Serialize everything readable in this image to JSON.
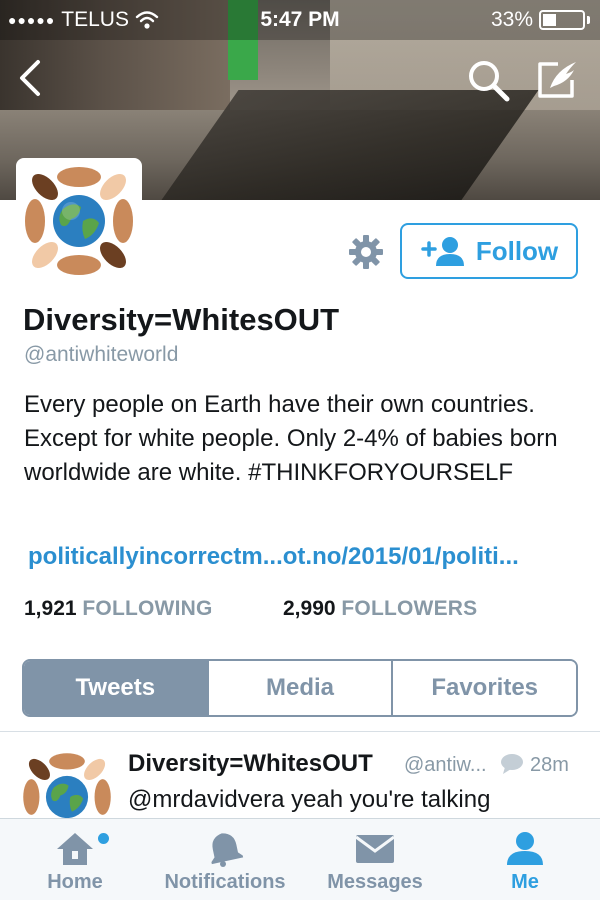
{
  "status_bar": {
    "signal_dots": "●●●●●",
    "carrier": "TELUS",
    "time": "5:47 PM",
    "battery_percent": "33%",
    "battery_level": 0.33
  },
  "header": {
    "back_icon": "chevron-left-icon",
    "search_icon": "search-icon",
    "compose_icon": "compose-icon"
  },
  "profile": {
    "display_name": "Diversity=WhitesOUT",
    "handle": "@antiwhiteworld",
    "bio": "Every people on Earth have their own countries. Except for white people. Only 2-4% of babies born worldwide are white. #THINKFORYOURSELF",
    "website": "politicallyincorrectm...ot.no/2015/01/politi...",
    "following_count": "1,921",
    "following_label": "FOLLOWING",
    "followers_count": "2,990",
    "followers_label": "FOLLOWERS",
    "follow_label": "Follow"
  },
  "tabs": [
    {
      "label": "Tweets",
      "active": true
    },
    {
      "label": "Media",
      "active": false
    },
    {
      "label": "Favorites",
      "active": false
    }
  ],
  "tweet": {
    "author": "Diversity=WhitesOUT",
    "handle": "@antiw...",
    "time": "28m",
    "text": "@mrdavidvera yeah you're talking"
  },
  "bottom_nav": [
    {
      "label": "Home",
      "icon": "home-icon",
      "active": false,
      "has_dot": true
    },
    {
      "label": "Notifications",
      "icon": "bell-icon",
      "active": false,
      "has_dot": false
    },
    {
      "label": "Messages",
      "icon": "envelope-icon",
      "active": false,
      "has_dot": false
    },
    {
      "label": "Me",
      "icon": "person-icon",
      "active": true,
      "has_dot": false
    }
  ],
  "colors": {
    "accent": "#2e9fe0",
    "tab_gray": "#8094a8",
    "link": "#2b8fd0",
    "muted": "#8899a6"
  }
}
